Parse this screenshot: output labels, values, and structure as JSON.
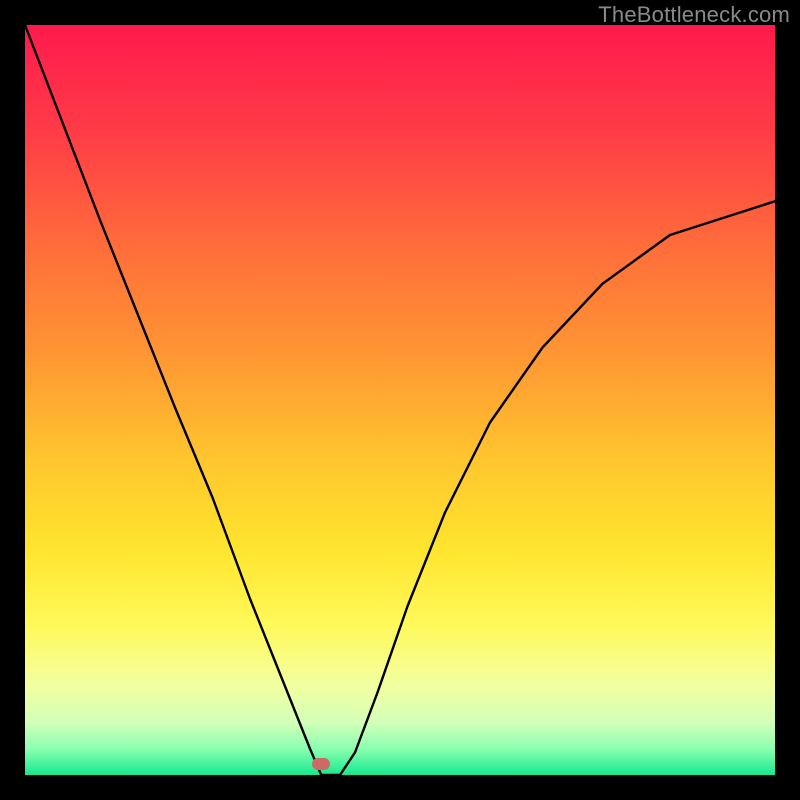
{
  "watermark": "TheBottleneck.com",
  "gradient_stops": [
    {
      "offset": 0.0,
      "color": "#ff1a4d"
    },
    {
      "offset": 0.14,
      "color": "#ff3b47"
    },
    {
      "offset": 0.3,
      "color": "#ff6e3a"
    },
    {
      "offset": 0.45,
      "color": "#ff9933"
    },
    {
      "offset": 0.58,
      "color": "#ffc62e"
    },
    {
      "offset": 0.7,
      "color": "#ffe52e"
    },
    {
      "offset": 0.8,
      "color": "#fff95a"
    },
    {
      "offset": 0.88,
      "color": "#f3ffa0"
    },
    {
      "offset": 0.93,
      "color": "#d3ffb8"
    },
    {
      "offset": 0.965,
      "color": "#8affb0"
    },
    {
      "offset": 1.0,
      "color": "#17e890"
    }
  ],
  "optimal_x": 0.395,
  "chart_data": {
    "type": "line",
    "title": "",
    "xlabel": "",
    "ylabel": "",
    "xlim": [
      0,
      1
    ],
    "ylim": [
      0,
      1
    ],
    "series": [
      {
        "name": "bottleneck-curve",
        "x": [
          0.0,
          0.05,
          0.1,
          0.15,
          0.2,
          0.25,
          0.3,
          0.33,
          0.36,
          0.38,
          0.395,
          0.42,
          0.44,
          0.47,
          0.51,
          0.56,
          0.62,
          0.69,
          0.77,
          0.86,
          1.0
        ],
        "y": [
          1.0,
          0.87,
          0.74,
          0.615,
          0.49,
          0.37,
          0.235,
          0.16,
          0.085,
          0.035,
          0.0,
          0.0,
          0.03,
          0.11,
          0.225,
          0.35,
          0.47,
          0.57,
          0.655,
          0.72,
          0.765
        ]
      }
    ],
    "marker": {
      "x": 0.395,
      "y": 0.015,
      "color": "#cc6a66"
    },
    "grid": false,
    "legend": false
  }
}
